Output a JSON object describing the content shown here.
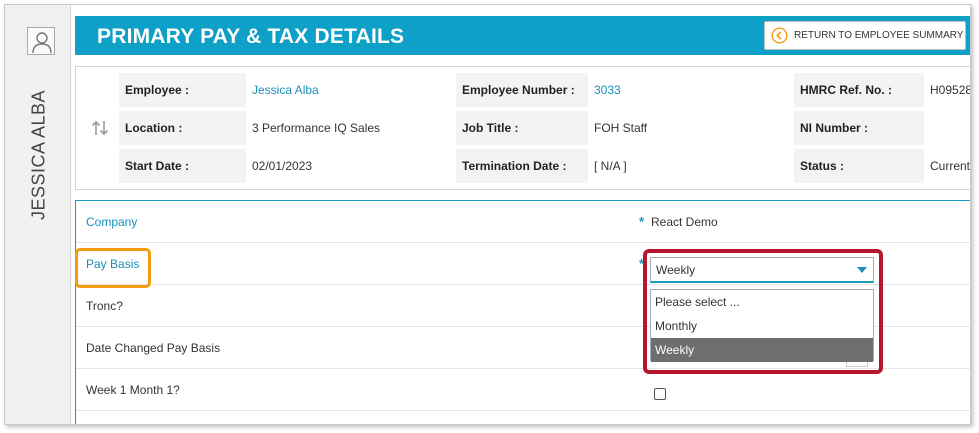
{
  "sidebar": {
    "employee_name": "JESSICA ALBA",
    "avatar_icon": "user-icon"
  },
  "header": {
    "title": "PRIMARY PAY & TAX DETAILS",
    "return_label": "RETURN TO EMPLOYEE SUMMARY",
    "return_icon": "chevron-left-circle-icon",
    "color": "#0ea0c6"
  },
  "info": {
    "swap_icon": "swap-vertical-icon",
    "employee_label": "Employee :",
    "employee_value": "Jessica Alba",
    "employee_number_label": "Employee Number :",
    "employee_number_value": "3033",
    "hmrc_label": "HMRC Ref. No. :",
    "hmrc_value": "H09528",
    "location_label": "Location :",
    "location_value": "3 Performance IQ Sales",
    "job_title_label": "Job Title :",
    "job_title_value": "FOH Staff",
    "ni_label": "NI Number :",
    "ni_value": "",
    "start_date_label": "Start Date :",
    "start_date_value": "02/01/2023",
    "termination_label": "Termination Date :",
    "termination_value": "[ N/A ]",
    "status_label": "Status :",
    "status_value": "Current"
  },
  "form": {
    "company_label": "Company",
    "company_value": "React Demo",
    "required_mark": "*",
    "pay_basis_label": "Pay Basis",
    "pay_basis_value": "Weekly",
    "pay_basis_options": [
      "Please select ...",
      "Monthly",
      "Weekly"
    ],
    "tronc_label": "Tronc?",
    "date_changed_label": "Date Changed Pay Basis",
    "week1_label": "Week 1 Month 1?",
    "week1_checked": false
  },
  "colors": {
    "accent": "#1a90b8",
    "highlight_orange": "#f39c12",
    "highlight_red": "#b5182e"
  }
}
